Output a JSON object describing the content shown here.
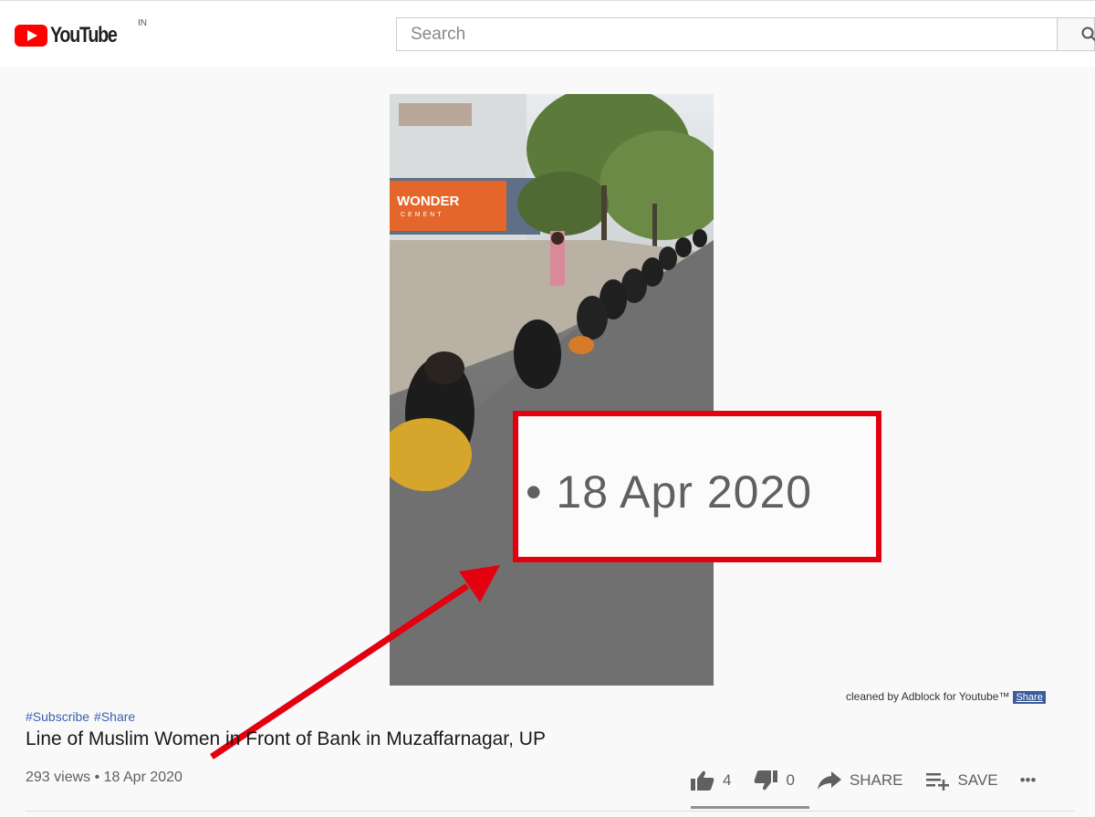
{
  "header": {
    "logo_text": "YouTube",
    "country": "IN",
    "search_placeholder": "Search"
  },
  "zoom_annotation": {
    "text": "• 18 Apr 2020",
    "border_color": "#e3000f"
  },
  "video_overlay": {
    "banner_text": "WONDER",
    "banner_subtext": "CEMENT"
  },
  "credit": {
    "text": "cleaned by Adblock for Youtube™",
    "share_label": "Share"
  },
  "video_info": {
    "hashtags": [
      "#Subscribe",
      "#Share"
    ],
    "title": "Line of Muslim Women in Front of Bank in Muzaffarnagar, UP",
    "meta": "293 views • 18 Apr 2020"
  },
  "actions": {
    "likes": "4",
    "dislikes": "0",
    "share_label": "SHARE",
    "save_label": "SAVE",
    "more_label": "•••"
  },
  "colors": {
    "youtube_red": "#ff0000",
    "annotation_red": "#e3000f",
    "hashtag_blue": "#3861b0"
  }
}
